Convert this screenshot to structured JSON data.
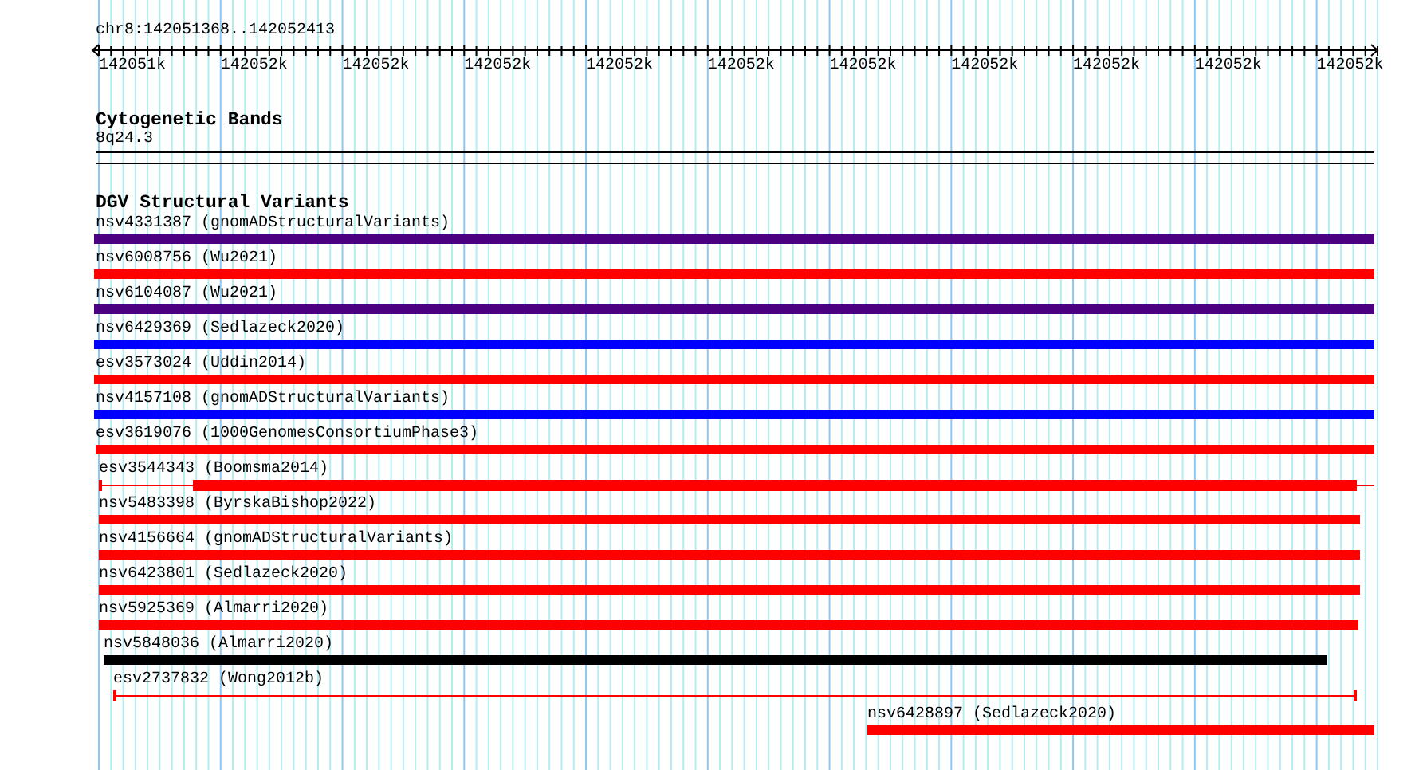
{
  "ruler": {
    "location": "chr8:142051368..142052413",
    "ticks": [
      "142051k",
      "142052k",
      "142052k",
      "142052k",
      "142052k",
      "142052k",
      "142052k",
      "142052k",
      "142052k",
      "142052k",
      "142052k"
    ]
  },
  "tracks": [
    {
      "title": "Cytogenetic Bands",
      "features": [
        {
          "label": "8q24.3",
          "kind": "band"
        }
      ]
    },
    {
      "title": "DGV Structural Variants",
      "features": [
        {
          "label": "nsv4331387 (gnomADStructuralVariants)",
          "color": "#4b0082",
          "kind": "solid"
        },
        {
          "label": "nsv6008756 (Wu2021)",
          "color": "#ff0000",
          "kind": "solid"
        },
        {
          "label": "nsv6104087 (Wu2021)",
          "color": "#4b0082",
          "kind": "solid"
        },
        {
          "label": "nsv6429369 (Sedlazeck2020)",
          "color": "#0000ff",
          "kind": "solid"
        },
        {
          "label": "esv3573024 (Uddin2014)",
          "color": "#ff0000",
          "kind": "solid"
        },
        {
          "label": "nsv4157108 (gnomADStructuralVariants)",
          "color": "#0000ff",
          "kind": "solid"
        },
        {
          "label": "esv3619076 (1000GenomesConsortiumPhase3)",
          "color": "#ff0000",
          "kind": "solid"
        },
        {
          "label": "esv3544343 (Boomsma2014)",
          "color": "#ff0000",
          "kind": "partial"
        },
        {
          "label": "nsv5483398 (ByrskaBishop2022)",
          "color": "#ff0000",
          "kind": "solid"
        },
        {
          "label": "nsv4156664 (gnomADStructuralVariants)",
          "color": "#ff0000",
          "kind": "solid"
        },
        {
          "label": "nsv6423801 (Sedlazeck2020)",
          "color": "#ff0000",
          "kind": "solid"
        },
        {
          "label": "nsv5925369 (Almarri2020)",
          "color": "#ff0000",
          "kind": "solid"
        },
        {
          "label": "nsv5848036 (Almarri2020)",
          "color": "#000000",
          "kind": "solid"
        },
        {
          "label": "esv2737832 (Wong2012b)",
          "color": "#ff0000",
          "kind": "thin"
        },
        {
          "label": "nsv6428897 (Sedlazeck2020)",
          "color": "#ff0000",
          "kind": "solid"
        }
      ]
    }
  ]
}
